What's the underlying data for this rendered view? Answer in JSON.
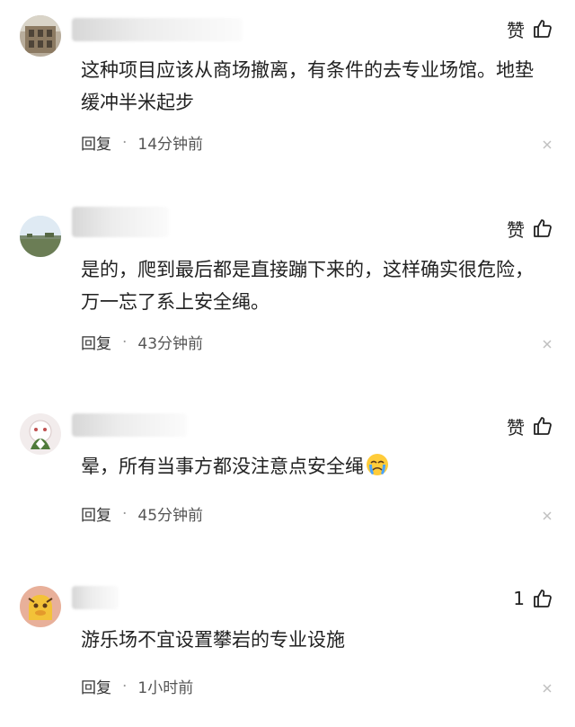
{
  "comments": [
    {
      "like_label": "赞",
      "text": "这种项目应该从商场撤离，有条件的去专业场馆。地垫缓冲半米起步",
      "reply_label": "回复",
      "time": "14分钟前"
    },
    {
      "like_label": "赞",
      "text": "是的，爬到最后都是直接蹦下来的，这样确实很危险，万一忘了系上安全绳。",
      "reply_label": "回复",
      "time": "43分钟前"
    },
    {
      "like_label": "赞",
      "text": "晕，所有当事方都没注意点安全绳",
      "text_emoji": "crying-face-emoji",
      "reply_label": "回复",
      "time": "45分钟前"
    },
    {
      "like_label": "1",
      "text": "游乐场不宜设置攀岩的专业设施",
      "reply_label": "回复",
      "time": "1小时前"
    }
  ],
  "separator": "·",
  "icons": {
    "like": "thumbs-up-icon",
    "close": "close-icon"
  }
}
